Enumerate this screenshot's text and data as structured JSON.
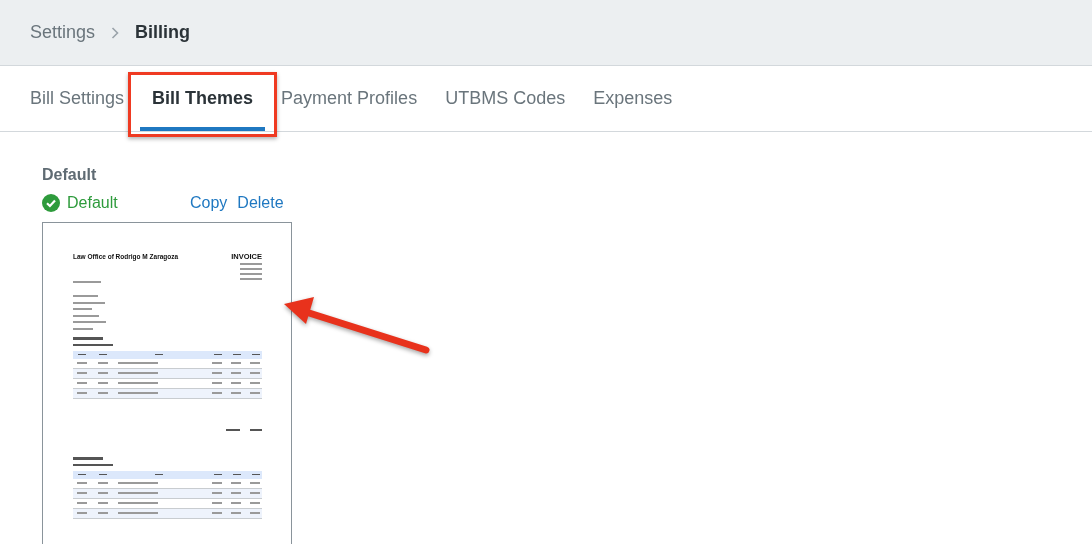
{
  "breadcrumb": [
    {
      "label": "Settings"
    },
    {
      "label": "Billing"
    }
  ],
  "tabs": [
    {
      "label": "Bill Settings",
      "selected": false,
      "highlighted": false
    },
    {
      "label": "Bill Themes",
      "selected": true,
      "highlighted": true
    },
    {
      "label": "Payment Profiles",
      "selected": false,
      "highlighted": false
    },
    {
      "label": "UTBMS Codes",
      "selected": false,
      "highlighted": false
    },
    {
      "label": "Expenses",
      "selected": false,
      "highlighted": false
    }
  ],
  "theme": {
    "name": "Default",
    "is_default": true,
    "status_label": "Default",
    "actions": [
      "Copy",
      "Delete"
    ],
    "preview": {
      "firm": "Law Office of Rodrigo M Zaragoza",
      "title": "INVOICE"
    }
  },
  "annotations": [
    {
      "kind": "arrow"
    }
  ]
}
